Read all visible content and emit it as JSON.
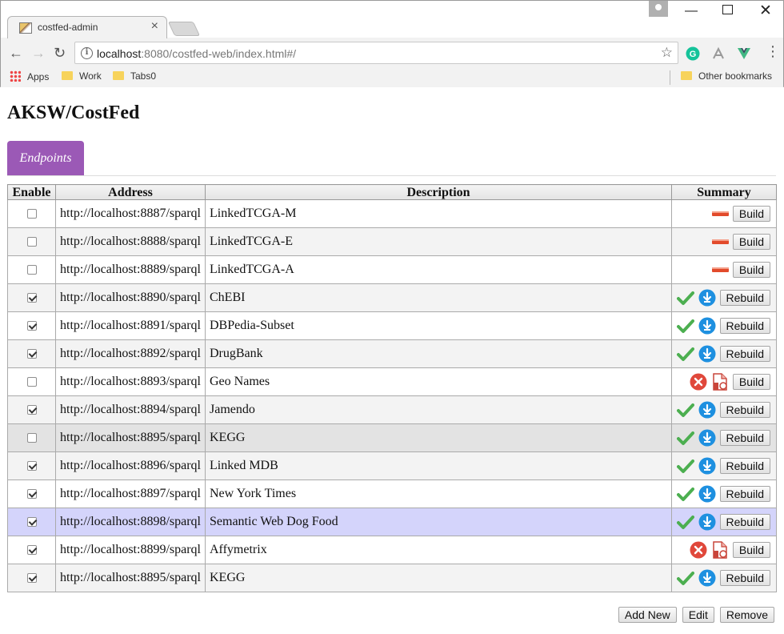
{
  "browser": {
    "tab_title": "costfed-admin",
    "url_host": "localhost",
    "url_rest": ":8080/costfed-web/index.html#/",
    "bookmarks": [
      "Apps",
      "Work",
      "Tabs0"
    ],
    "other_bookmarks": "Other bookmarks"
  },
  "page": {
    "title": "AKSW/CostFed",
    "tabs": [
      "Endpoints"
    ]
  },
  "table": {
    "headers": [
      "Enable",
      "Address",
      "Description",
      "Summary"
    ],
    "rows": [
      {
        "enabled": false,
        "address": "http://localhost:8887/sparql",
        "description": "LinkedTCGA-M",
        "status": "none",
        "action": "Build"
      },
      {
        "enabled": false,
        "address": "http://localhost:8888/sparql",
        "description": "LinkedTCGA-E",
        "status": "none",
        "action": "Build"
      },
      {
        "enabled": false,
        "address": "http://localhost:8889/sparql",
        "description": "LinkedTCGA-A",
        "status": "none",
        "action": "Build"
      },
      {
        "enabled": true,
        "address": "http://localhost:8890/sparql",
        "description": "ChEBI",
        "status": "ok",
        "action": "Rebuild"
      },
      {
        "enabled": true,
        "address": "http://localhost:8891/sparql",
        "description": "DBPedia-Subset",
        "status": "ok",
        "action": "Rebuild"
      },
      {
        "enabled": true,
        "address": "http://localhost:8892/sparql",
        "description": "DrugBank",
        "status": "ok",
        "action": "Rebuild"
      },
      {
        "enabled": false,
        "address": "http://localhost:8893/sparql",
        "description": "Geo Names",
        "status": "error",
        "action": "Build"
      },
      {
        "enabled": true,
        "address": "http://localhost:8894/sparql",
        "description": "Jamendo",
        "status": "ok",
        "action": "Rebuild"
      },
      {
        "enabled": false,
        "address": "http://localhost:8895/sparql",
        "description": "KEGG",
        "status": "ok",
        "action": "Rebuild"
      },
      {
        "enabled": true,
        "address": "http://localhost:8896/sparql",
        "description": "Linked MDB",
        "status": "ok",
        "action": "Rebuild"
      },
      {
        "enabled": true,
        "address": "http://localhost:8897/sparql",
        "description": "New York Times",
        "status": "ok",
        "action": "Rebuild"
      },
      {
        "enabled": true,
        "address": "http://localhost:8898/sparql",
        "description": "Semantic Web Dog Food",
        "status": "ok",
        "action": "Rebuild"
      },
      {
        "enabled": true,
        "address": "http://localhost:8899/sparql",
        "description": "Affymetrix",
        "status": "error",
        "action": "Build"
      },
      {
        "enabled": true,
        "address": "http://localhost:8895/sparql",
        "description": "KEGG",
        "status": "ok",
        "action": "Rebuild"
      }
    ]
  },
  "actions": {
    "add_new": "Add New",
    "edit": "Edit",
    "remove": "Remove"
  },
  "colors": {
    "accent_tab": "#9b59b6",
    "selected_row": "#d4d4fb",
    "ok_check": "#4caf50",
    "download": "#1e90e0",
    "error": "#e0483b"
  }
}
